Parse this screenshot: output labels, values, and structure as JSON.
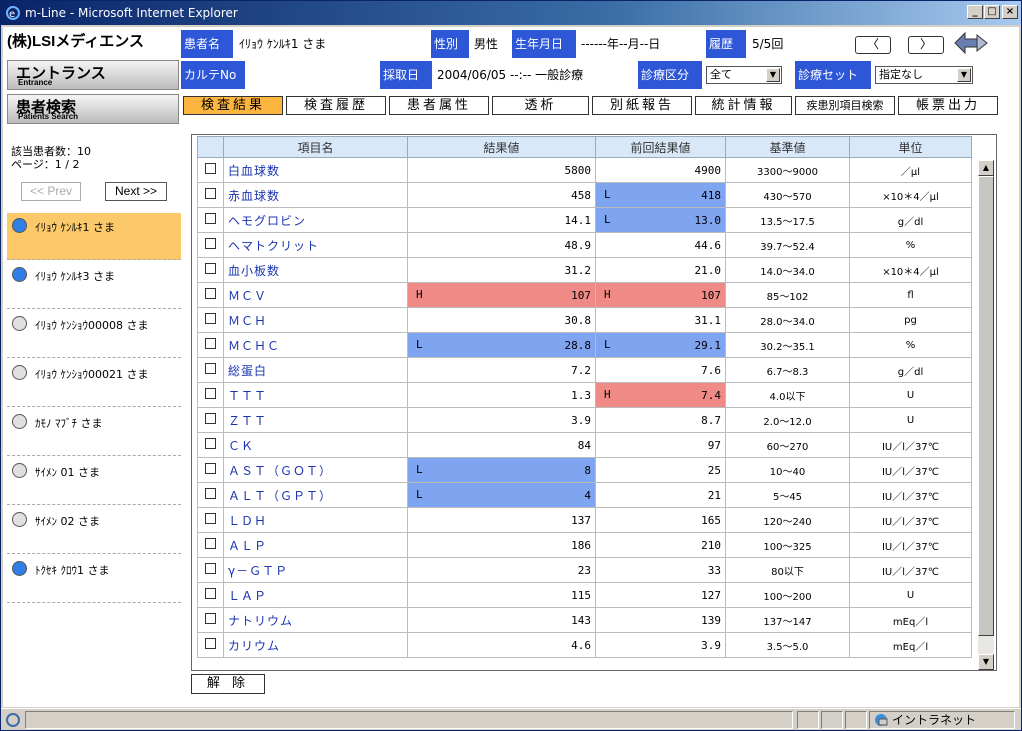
{
  "window": {
    "title": "m-Line - Microsoft Internet Explorer"
  },
  "sidebar": {
    "logo": "(株)LSIメディエンス",
    "nav": [
      {
        "jp": "エントランス",
        "en": "Entrance"
      },
      {
        "jp": "患者検索",
        "en": "Patients Search"
      }
    ],
    "count_label": "該当患者数：10",
    "page_label": "ページ：1 / 2",
    "prev_label": "<< Prev",
    "next_label": "Next >>",
    "patients": [
      {
        "name": "ｲﾘｮｳ ｹﾝﾙｷ1 さま",
        "dot": "#2f7fe6",
        "selected": true
      },
      {
        "name": "ｲﾘｮｳ ｹﾝﾙｷ3 さま",
        "dot": "#2f7fe6",
        "selected": false
      },
      {
        "name": "ｲﾘｮｳ ｹﾝｼｮｳ00008 さま",
        "dot": "#e0e0e0",
        "selected": false
      },
      {
        "name": "ｲﾘｮｳ ｹﾝｼｮｳ00021 さま",
        "dot": "#e0e0e0",
        "selected": false
      },
      {
        "name": "ｶﾓﾉ ﾏﾌﾞﾁ さま",
        "dot": "#e0e0e0",
        "selected": false
      },
      {
        "name": "ｻｲﾒﾝ 01 さま",
        "dot": "#e0e0e0",
        "selected": false
      },
      {
        "name": "ｻｲﾒﾝ 02 さま",
        "dot": "#e0e0e0",
        "selected": false
      },
      {
        "name": "ﾄｸｾｷ ｸﾛｳ1 さま",
        "dot": "#2f7fe6",
        "selected": false
      }
    ]
  },
  "header": {
    "patient_label": "患者名",
    "patient_name": "ｲﾘｮｳ ｹﾝﾙｷ1 さま",
    "sex_label": "性別",
    "sex": "男性",
    "dob_label": "生年月日",
    "dob": "------年--月--日",
    "history_label": "履歴",
    "history": "5/5回",
    "karte_label": "カルテNo",
    "karte": "",
    "collect_label": "採取日",
    "collect": "2004/06/05 --:-- 一般診療",
    "dept_label": "診療区分",
    "dept_value": "全て",
    "set_label": "診療セット",
    "set_value": "指定なし",
    "prev_arrow": "〈",
    "next_arrow": "〉"
  },
  "tabs": [
    "検査結果",
    "検査履歴",
    "患者属性",
    "透析",
    "別紙報告",
    "統計情報",
    "疾患別項目検索",
    "帳票出力"
  ],
  "grid": {
    "columns": [
      "項目名",
      "結果値",
      "前回結果値",
      "基準値",
      "単位"
    ],
    "rows": [
      {
        "name": "白血球数",
        "result": "5800",
        "rflag": "",
        "prev": "4900",
        "pflag": "",
        "ref": "3300〜9000",
        "unit": "／μl"
      },
      {
        "name": "赤血球数",
        "result": "458",
        "rflag": "",
        "prev": "418",
        "pflag": "L",
        "ref": "430〜570",
        "unit": "×10＊4／μl"
      },
      {
        "name": "ヘモグロビン",
        "result": "14.1",
        "rflag": "",
        "prev": "13.0",
        "pflag": "L",
        "ref": "13.5〜17.5",
        "unit": "g／dl"
      },
      {
        "name": "ヘマトクリット",
        "result": "48.9",
        "rflag": "",
        "prev": "44.6",
        "pflag": "",
        "ref": "39.7〜52.4",
        "unit": "%"
      },
      {
        "name": "血小板数",
        "result": "31.2",
        "rflag": "",
        "prev": "21.0",
        "pflag": "",
        "ref": "14.0〜34.0",
        "unit": "×10＊4／μl"
      },
      {
        "name": "ＭＣＶ",
        "result": "107",
        "rflag": "H",
        "prev": "107",
        "pflag": "H",
        "ref": "85〜102",
        "unit": "fl"
      },
      {
        "name": "ＭＣＨ",
        "result": "30.8",
        "rflag": "",
        "prev": "31.1",
        "pflag": "",
        "ref": "28.0〜34.0",
        "unit": "pg"
      },
      {
        "name": "ＭＣＨＣ",
        "result": "28.8",
        "rflag": "L",
        "prev": "29.1",
        "pflag": "L",
        "ref": "30.2〜35.1",
        "unit": "%"
      },
      {
        "name": "総蛋白",
        "result": "7.2",
        "rflag": "",
        "prev": "7.6",
        "pflag": "",
        "ref": "6.7〜8.3",
        "unit": "g／dl"
      },
      {
        "name": "ＴＴＴ",
        "result": "1.3",
        "rflag": "",
        "prev": "7.4",
        "pflag": "H",
        "ref": "4.0以下",
        "unit": "U"
      },
      {
        "name": "ＺＴＴ",
        "result": "3.9",
        "rflag": "",
        "prev": "8.7",
        "pflag": "",
        "ref": "2.0〜12.0",
        "unit": "U"
      },
      {
        "name": "ＣＫ",
        "result": "84",
        "rflag": "",
        "prev": "97",
        "pflag": "",
        "ref": "60〜270",
        "unit": "IU／l／37℃"
      },
      {
        "name": "ＡＳＴ（ＧＯＴ）",
        "result": "8",
        "rflag": "L",
        "prev": "25",
        "pflag": "",
        "ref": "10〜40",
        "unit": "IU／l／37℃"
      },
      {
        "name": "ＡＬＴ（ＧＰＴ）",
        "result": "4",
        "rflag": "L",
        "prev": "21",
        "pflag": "",
        "ref": "5〜45",
        "unit": "IU／l／37℃"
      },
      {
        "name": "ＬＤＨ",
        "result": "137",
        "rflag": "",
        "prev": "165",
        "pflag": "",
        "ref": "120〜240",
        "unit": "IU／l／37℃"
      },
      {
        "name": "ＡＬＰ",
        "result": "186",
        "rflag": "",
        "prev": "210",
        "pflag": "",
        "ref": "100〜325",
        "unit": "IU／l／37℃"
      },
      {
        "name": "γ－ＧＴＰ",
        "result": "23",
        "rflag": "",
        "prev": "33",
        "pflag": "",
        "ref": "80以下",
        "unit": "IU／l／37℃"
      },
      {
        "name": "ＬＡＰ",
        "result": "115",
        "rflag": "",
        "prev": "127",
        "pflag": "",
        "ref": "100〜200",
        "unit": "U"
      },
      {
        "name": "ナトリウム",
        "result": "143",
        "rflag": "",
        "prev": "139",
        "pflag": "",
        "ref": "137〜147",
        "unit": "mEq／l"
      },
      {
        "name": "カリウム",
        "result": "4.6",
        "rflag": "",
        "prev": "3.9",
        "pflag": "",
        "ref": "3.5〜5.0",
        "unit": "mEq／l"
      }
    ]
  },
  "clear_label": "解 除",
  "status": {
    "zone": "イントラネット"
  }
}
